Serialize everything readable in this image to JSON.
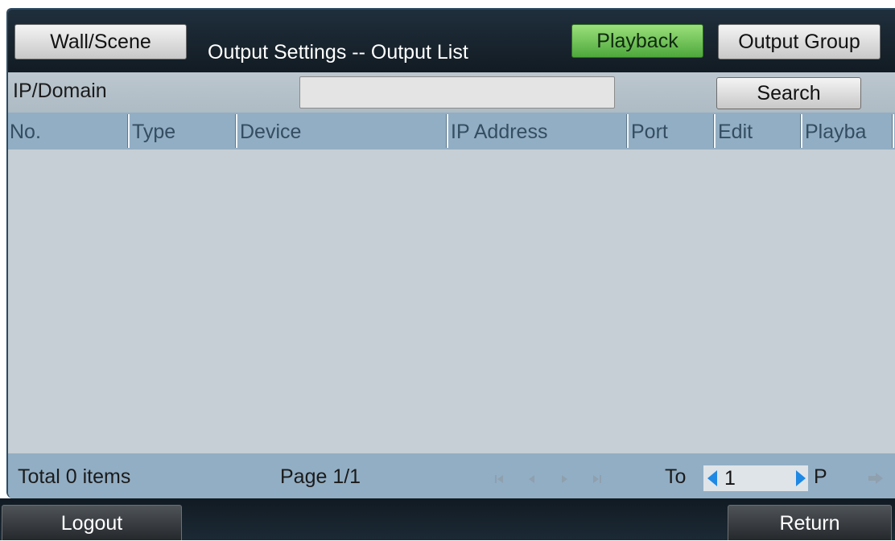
{
  "header": {
    "wall_scene_label": "Wall/Scene",
    "title": "Output Settings -- Output List",
    "playback_label": "Playback",
    "output_group_label": "Output Group"
  },
  "search": {
    "label": "IP/Domain",
    "value": "",
    "button_label": "Search"
  },
  "table": {
    "columns": [
      "No.",
      "Type",
      "Device",
      "IP Address",
      "Port",
      "Edit",
      "Playba"
    ],
    "rows": []
  },
  "footer": {
    "total_text": "Total 0 items",
    "page_text": "Page 1/1",
    "to_label": "To",
    "page_input": "1",
    "page_suffix": "P"
  },
  "bottom": {
    "logout_label": "Logout",
    "return_label": "Return"
  },
  "colors": {
    "accent_green": "#4ea83c",
    "header_blue": "#92aec4",
    "panel_bg": "#c6cfd5",
    "nav_arrow_blue": "#1e88e5"
  },
  "icons": [
    "first-page-icon",
    "previous-page-icon",
    "next-page-icon",
    "last-page-icon",
    "page-decrease-icon",
    "page-increase-icon",
    "go-page-icon"
  ]
}
